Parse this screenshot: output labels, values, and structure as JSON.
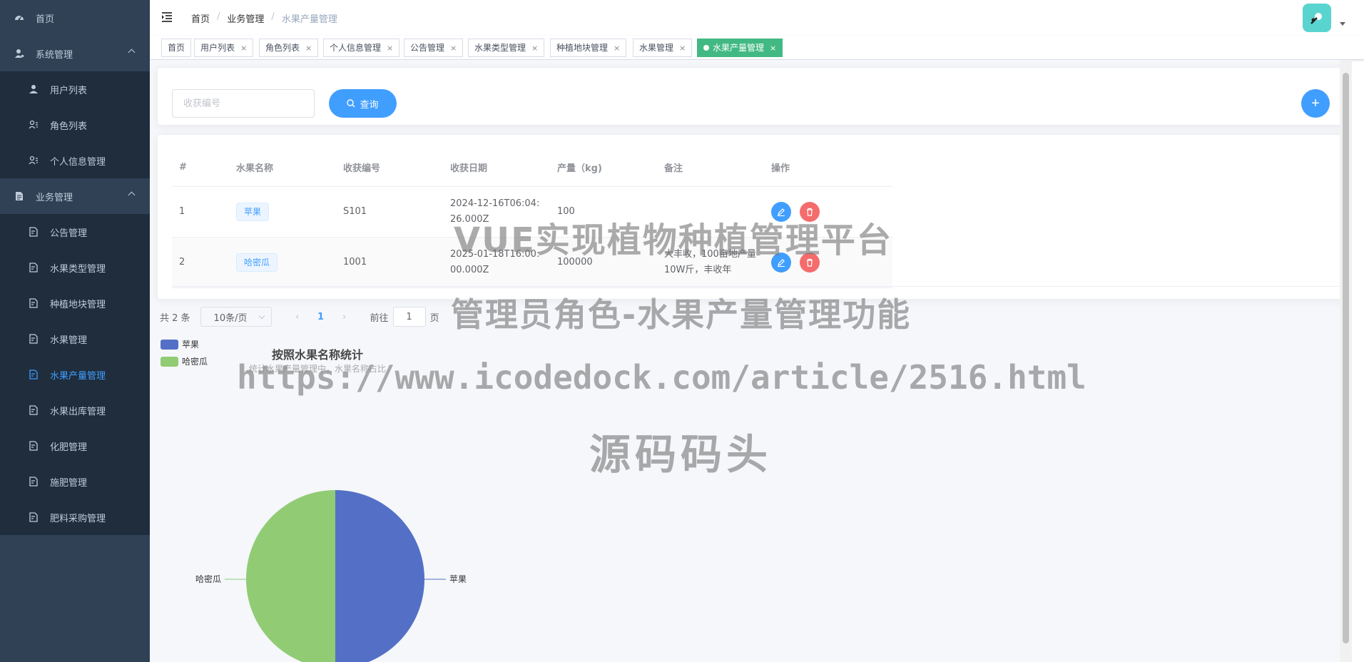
{
  "sidebar": {
    "home": "首页",
    "system": {
      "label": "系统管理",
      "items": [
        "用户列表",
        "角色列表",
        "个人信息管理"
      ]
    },
    "business": {
      "label": "业务管理",
      "items": [
        "公告管理",
        "水果类型管理",
        "种植地块管理",
        "水果管理",
        "水果产量管理",
        "水果出库管理",
        "化肥管理",
        "施肥管理",
        "肥料采购管理"
      ],
      "active": "水果产量管理"
    }
  },
  "breadcrumb": [
    "首页",
    "业务管理",
    "水果产量管理"
  ],
  "tags": [
    "首页",
    "用户列表",
    "角色列表",
    "个人信息管理",
    "公告管理",
    "水果类型管理",
    "种植地块管理",
    "水果管理",
    "水果产量管理"
  ],
  "tags_close": "×",
  "search": {
    "placeholder": "收获编号",
    "query_label": "查询",
    "add_label": "+"
  },
  "table": {
    "headers": [
      "#",
      "水果名称",
      "收获编号",
      "收获日期",
      "产量（kg)",
      "备注",
      "操作"
    ],
    "rows": [
      {
        "index": "1",
        "fruit": "苹果",
        "code": "S101",
        "date": "2024-12-16T06:04:26.000Z",
        "yield": "100",
        "note": ""
      },
      {
        "index": "2",
        "fruit": "哈密瓜",
        "code": "1001",
        "date": "2025-01-18T16:00:00.000Z",
        "yield": "100000",
        "note": "大丰收，100亩地产量10W斤，丰收年"
      }
    ]
  },
  "pagination": {
    "total": "共 2 条",
    "page_size": "10条/页",
    "prev": "‹",
    "current": "1",
    "next": "›",
    "goto_prefix": "前往",
    "goto_value": "1",
    "goto_suffix": "页"
  },
  "chart_data": {
    "type": "pie",
    "title": "按照水果名称统计",
    "subtitle": "统计水果产量管理中，水果名称占比",
    "categories": [
      "苹果",
      "哈密瓜"
    ],
    "values": [
      1,
      1
    ],
    "colors": [
      "#5470c6",
      "#91cc75"
    ],
    "legend_position": "top-left"
  },
  "watermarks": [
    "VUE实现植物种植管理平台",
    "管理员角色-水果产量管理功能",
    "https://www.icodedock.com/article/2516.html",
    "源码码头"
  ],
  "colors": {
    "sidebar_bg": "#304156",
    "accent": "#409eff",
    "danger": "#f56c6c",
    "active_tag": "#42b983"
  }
}
